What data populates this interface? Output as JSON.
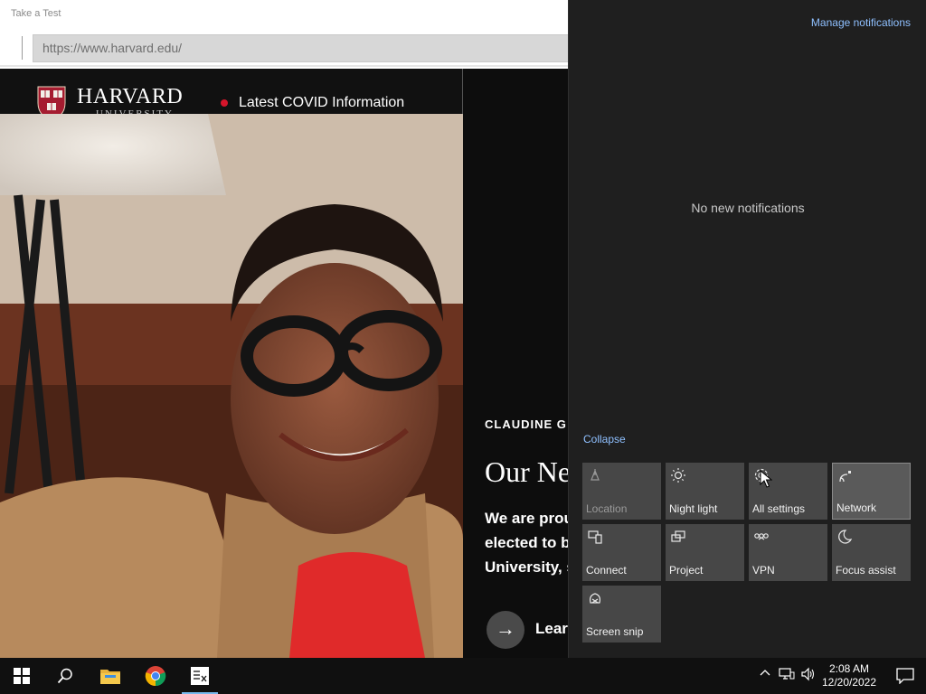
{
  "browser": {
    "window_title": "Take a Test",
    "url": "https://www.harvard.edu/"
  },
  "site": {
    "wordmark": "HARVARD",
    "wordmark_sub": "UNIVERSITY",
    "covid_link": "Latest COVID Information",
    "hero": {
      "eyebrow": "CLAUDINE G",
      "headline": "Our Ne",
      "body_lines": [
        "We are prou",
        "elected to b",
        "University, s"
      ],
      "learn_more": "Lear"
    },
    "colors": {
      "crimson": "#a51c30",
      "covid_dot": "#d5152b"
    }
  },
  "action_center": {
    "manage_notifications": "Manage notifications",
    "empty_message": "No new notifications",
    "collapse": "Collapse",
    "tiles": [
      {
        "label": "Location",
        "icon": "location-icon",
        "state": "disabled"
      },
      {
        "label": "Night light",
        "icon": "night-light-icon",
        "state": "off"
      },
      {
        "label": "All settings",
        "icon": "gear-icon",
        "state": "off"
      },
      {
        "label": "Network",
        "icon": "network-icon",
        "state": "on"
      },
      {
        "label": "Connect",
        "icon": "connect-icon",
        "state": "off"
      },
      {
        "label": "Project",
        "icon": "project-icon",
        "state": "off"
      },
      {
        "label": "VPN",
        "icon": "vpn-icon",
        "state": "off"
      },
      {
        "label": "Focus assist",
        "icon": "moon-icon",
        "state": "off"
      },
      {
        "label": "Screen snip",
        "icon": "screen-snip-icon",
        "state": "off"
      }
    ]
  },
  "taskbar": {
    "apps": [
      {
        "name": "windows-start",
        "icon": "windows-logo-icon"
      },
      {
        "name": "search",
        "icon": "search-icon"
      },
      {
        "name": "file-explorer",
        "icon": "folder-icon"
      },
      {
        "name": "chrome",
        "icon": "chrome-icon"
      },
      {
        "name": "take-a-test",
        "icon": "take-a-test-icon",
        "active": true
      }
    ],
    "clock": {
      "time": "2:08 AM",
      "date": "12/20/2022"
    }
  }
}
